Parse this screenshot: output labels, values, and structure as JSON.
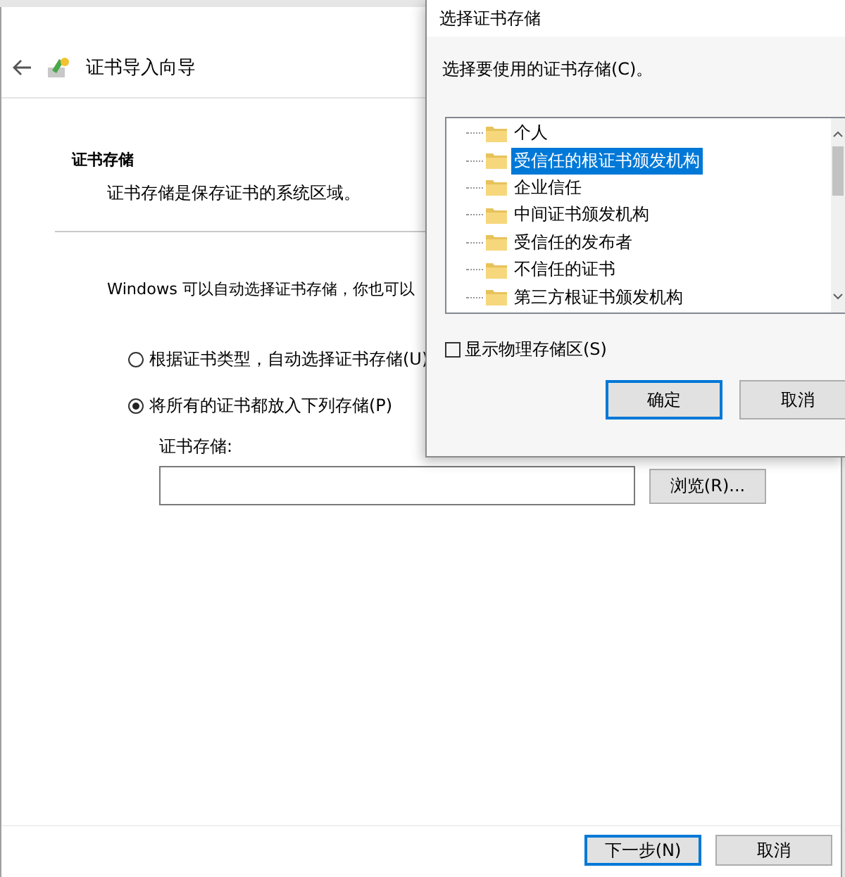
{
  "wizard": {
    "title": "证书导入向导",
    "section_title": "证书存储",
    "section_description": "证书存储是保存证书的系统区域。",
    "intro": "Windows 可以自动选择证书存储，你也可以",
    "options": [
      {
        "label": "根据证书类型，自动选择证书存储(U)",
        "selected": false
      },
      {
        "label": "将所有的证书都放入下列存储(P)",
        "selected": true
      }
    ],
    "store_field": {
      "label": "证书存储:"
    },
    "browse_button": "浏览(R)...",
    "buttons": [
      {
        "label": "下一步(N)",
        "focused": true
      },
      {
        "label": "取消",
        "focused": false
      }
    ]
  },
  "dialog": {
    "title": "选择证书存储",
    "prompt": "选择要使用的证书存储(C)。",
    "stores": [
      {
        "label": "个人",
        "selected": false
      },
      {
        "label": "受信任的根证书颁发机构",
        "selected": true
      },
      {
        "label": "企业信任",
        "selected": false
      },
      {
        "label": "中间证书颁发机构",
        "selected": false
      },
      {
        "label": "受信任的发布者",
        "selected": false
      },
      {
        "label": "不信任的证书",
        "selected": false
      },
      {
        "label": "第三方根证书颁发机构",
        "selected": false
      }
    ],
    "show_physical": {
      "label": "显示物理存储区(S)",
      "checked": false
    },
    "buttons": [
      {
        "label": "确定",
        "focused": true
      },
      {
        "label": "取消",
        "focused": false
      }
    ]
  }
}
